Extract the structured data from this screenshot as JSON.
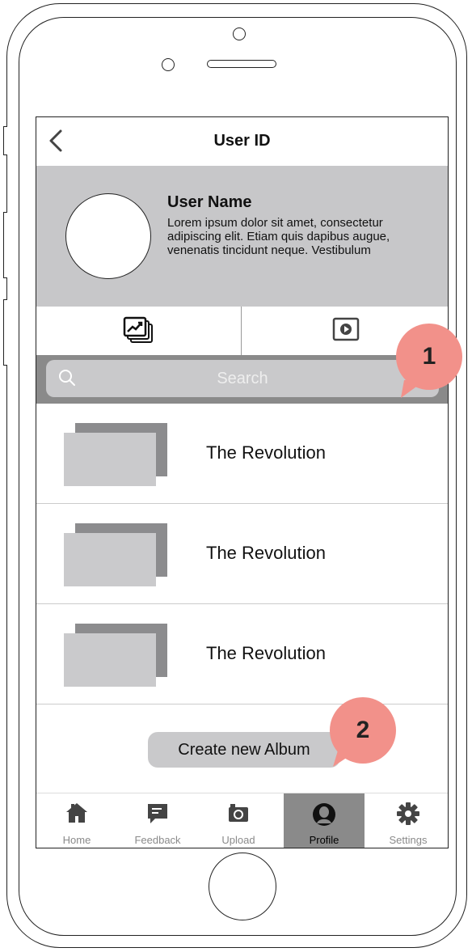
{
  "nav": {
    "title": "User ID",
    "back_icon": "chevron-left-icon"
  },
  "profile": {
    "name": "User Name",
    "description": "Lorem ipsum dolor sit amet, consectetur adipiscing elit. Etiam quis dapibus augue, venenatis tincidunt neque. Vestibulum"
  },
  "tabs": [
    {
      "icon": "photo-album-icon"
    },
    {
      "icon": "video-play-icon"
    }
  ],
  "search": {
    "placeholder": "Search"
  },
  "albums": [
    {
      "title": "The Revolution"
    },
    {
      "title": "The Revolution"
    },
    {
      "title": "The Revolution"
    }
  ],
  "create_button": {
    "label": "Create new Album"
  },
  "tabbar": {
    "items": [
      {
        "label": "Home",
        "icon": "home-icon"
      },
      {
        "label": "Feedback",
        "icon": "feedback-icon"
      },
      {
        "label": "Upload",
        "icon": "camera-icon"
      },
      {
        "label": "Profile",
        "icon": "profile-icon",
        "active": true
      },
      {
        "label": "Settings",
        "icon": "gear-icon"
      }
    ]
  },
  "annotations": [
    {
      "number": "1"
    },
    {
      "number": "2"
    }
  ],
  "colors": {
    "header_bg": "#c7c7c9",
    "search_bar_bg": "#8a8a8a",
    "badge": "#f2918a",
    "active_tab": "#8a8a8a"
  }
}
